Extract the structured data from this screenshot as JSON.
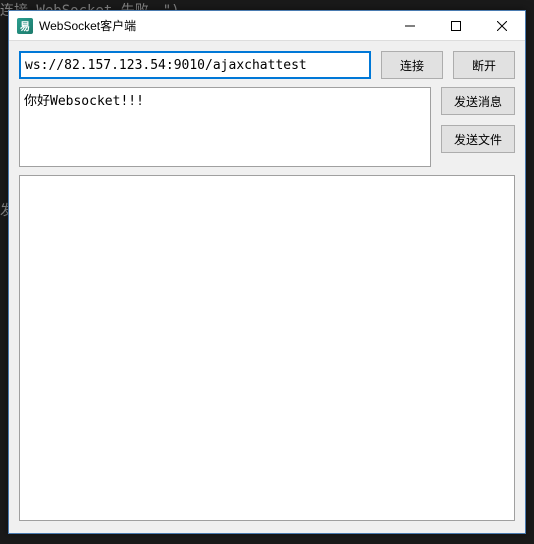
{
  "background": {
    "snippet1": "连接 WebSocket 失败。\")",
    "snippet2": "发"
  },
  "window": {
    "title": "WebSocket客户端",
    "icon_label": "易"
  },
  "controls": {
    "minimize": "–",
    "maximize": "□",
    "close": "×"
  },
  "form": {
    "url_value": "ws://82.157.123.54:9010/ajaxchattest",
    "message_value": "你好Websocket!!!",
    "log_value": ""
  },
  "buttons": {
    "connect": "连接",
    "disconnect": "断开",
    "send_message": "发送消息",
    "send_file": "发送文件"
  }
}
